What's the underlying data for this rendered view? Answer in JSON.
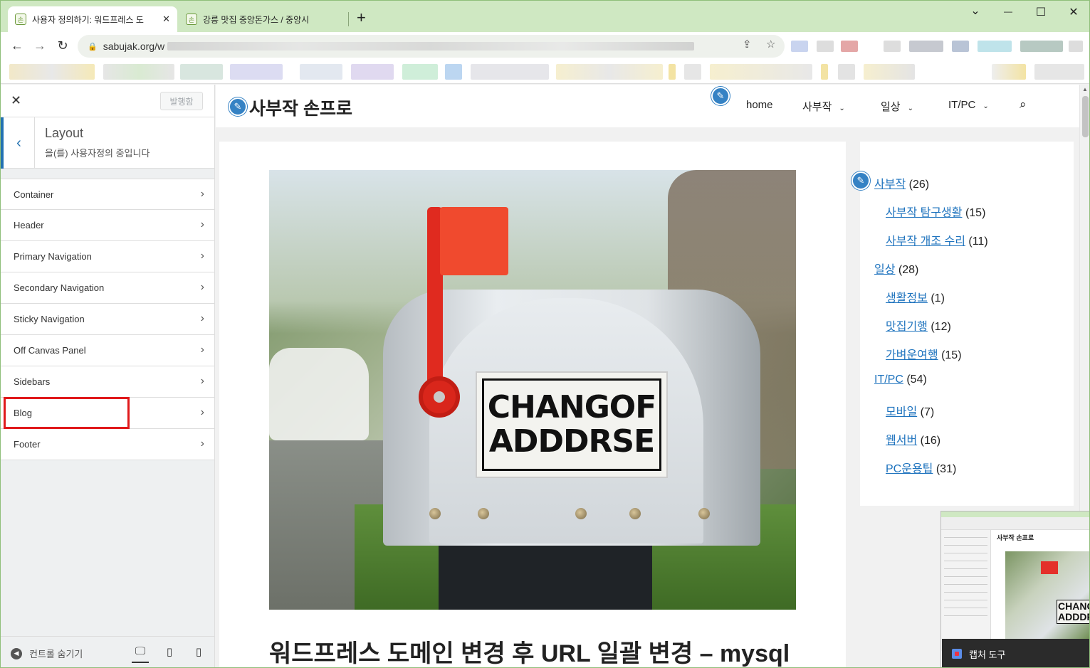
{
  "browser": {
    "tabs": [
      {
        "title": "사용자 정의하기: 워드프레스 도",
        "favicon": "손",
        "active": true
      },
      {
        "title": "강릉 맛집 중앙돈가스 / 중앙시",
        "favicon": "손",
        "active": false
      }
    ],
    "new_tab": "+",
    "url": "sabujak.org/w",
    "window_controls": {
      "dropdown": "⌄",
      "minimize": "—",
      "maximize": "☐",
      "close": "✕"
    }
  },
  "customizer": {
    "close": "✕",
    "publish_label": "발행함",
    "section_title": "Layout",
    "section_subtitle": "을(를) 사용자정의 중입니다",
    "items": [
      {
        "label": "Container"
      },
      {
        "label": "Header"
      },
      {
        "label": "Primary Navigation"
      },
      {
        "label": "Secondary Navigation"
      },
      {
        "label": "Sticky Navigation"
      },
      {
        "label": "Off Canvas Panel"
      },
      {
        "label": "Sidebars"
      },
      {
        "label": "Blog"
      },
      {
        "label": "Footer"
      }
    ],
    "hide_controls_label": "컨트롤 숨기기",
    "highlight_color": "#e0191b"
  },
  "site": {
    "title": "사부작 손프로",
    "nav": [
      {
        "label": "home",
        "has_dropdown": false
      },
      {
        "label": "사부작",
        "has_dropdown": true
      },
      {
        "label": "일상",
        "has_dropdown": true
      },
      {
        "label": "IT/PC",
        "has_dropdown": true
      }
    ],
    "hero_label_lines": [
      "CHANGOF",
      "ADDDRSE"
    ],
    "post_title": "워드프레스 도메인 변경 후 URL 일괄 변경 – mysql",
    "categories": [
      {
        "name": "사부작",
        "count": "(26)",
        "level": 0
      },
      {
        "name": "사부작 탐구생활",
        "count": "(15)",
        "level": 1
      },
      {
        "name": "사부작 개조 수리",
        "count": "(11)",
        "level": 1
      },
      {
        "name": "일상",
        "count": "(28)",
        "level": 0
      },
      {
        "name": "생활정보",
        "count": "(1)",
        "level": 1
      },
      {
        "name": "맛집기행",
        "count": "(12)",
        "level": 1
      },
      {
        "name": "가벼운여행",
        "count": "(15)",
        "level": 1
      },
      {
        "name": "IT/PC",
        "count": "(54)",
        "level": 0
      },
      {
        "name": "모바일",
        "count": "(7)",
        "level": 1
      },
      {
        "name": "웹서버",
        "count": "(16)",
        "level": 1
      },
      {
        "name": "PC운용팁",
        "count": "(31)",
        "level": 1
      }
    ],
    "link_color": "#1e73be",
    "accent_color": "#3582c4"
  },
  "overlay": {
    "thumb_title": "사부작 손프로",
    "thumb_label_lines": [
      "CHANGO",
      "ADDDRS"
    ],
    "capture_label": "캡처 도구"
  }
}
